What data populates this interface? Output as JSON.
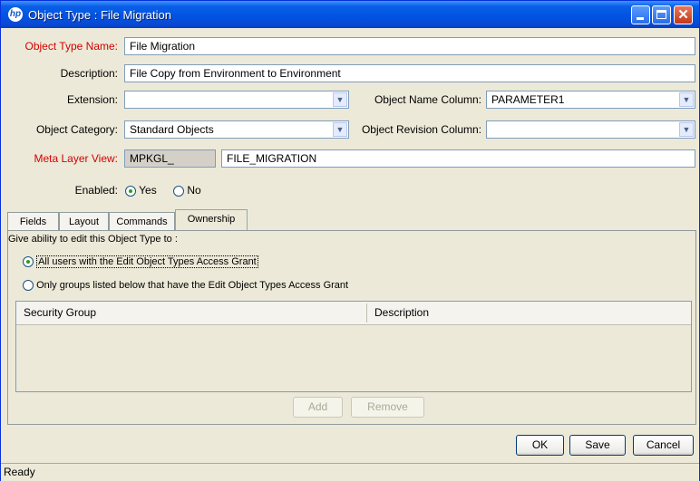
{
  "window": {
    "title": "Object Type : File Migration",
    "app_icon": "hp",
    "controls": {
      "minimize": "minimize-icon",
      "maximize": "maximize-icon",
      "close": "close-icon"
    }
  },
  "form": {
    "object_type_name": {
      "label": "Object Type Name:",
      "value": "File Migration"
    },
    "description": {
      "label": "Description:",
      "value": "File Copy from Environment to Environment"
    },
    "extension": {
      "label": "Extension:",
      "value": ""
    },
    "object_name_column": {
      "label": "Object Name Column:",
      "value": "PARAMETER1"
    },
    "object_category": {
      "label": "Object Category:",
      "value": "Standard Objects"
    },
    "object_revision_column": {
      "label": "Object Revision Column:",
      "value": ""
    },
    "meta_layer_view": {
      "label": "Meta Layer View:",
      "prefix": "MPKGL_",
      "value": "FILE_MIGRATION"
    },
    "enabled": {
      "label": "Enabled:",
      "yes": "Yes",
      "no": "No",
      "selected": "Yes"
    }
  },
  "tabs": [
    {
      "label": "Fields",
      "active": false
    },
    {
      "label": "Layout",
      "active": false
    },
    {
      "label": "Commands",
      "active": false
    },
    {
      "label": "Ownership",
      "active": true
    }
  ],
  "ownership": {
    "heading": "Give ability to edit this Object Type to :",
    "option_all": "All users with the Edit Object Types Access Grant",
    "option_groups": "Only groups listed below that have the Edit Object Types Access Grant",
    "selected": "all",
    "table": {
      "columns": [
        "Security Group",
        "Description"
      ],
      "rows": []
    },
    "add_label": "Add",
    "remove_label": "Remove"
  },
  "footer": {
    "ok_label": "OK",
    "save_label": "Save",
    "cancel_label": "Cancel"
  },
  "status": "Ready"
}
